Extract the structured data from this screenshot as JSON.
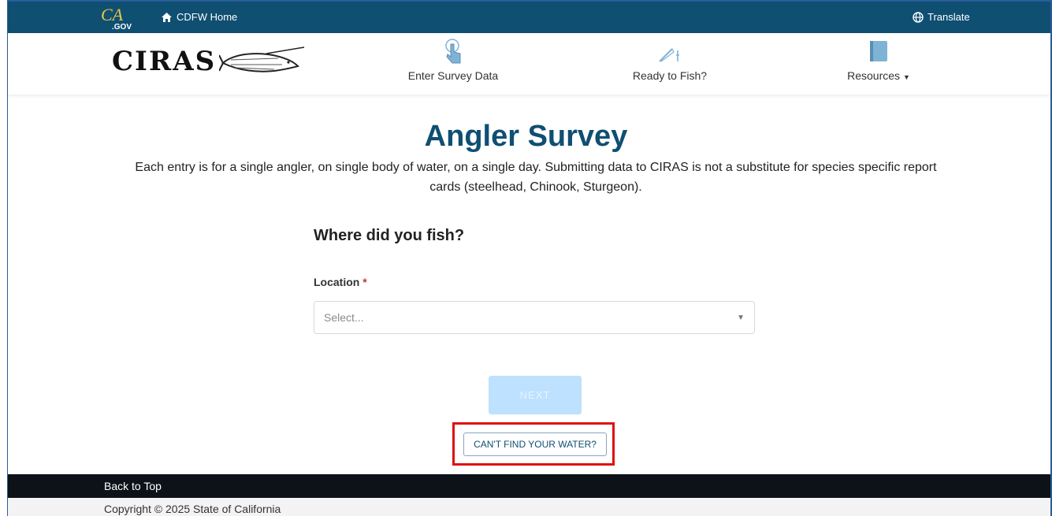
{
  "topbar": {
    "ca_logo_text": "CA",
    "ca_logo_gov": ".GOV",
    "home_label": "CDFW Home",
    "translate_label": "Translate"
  },
  "nav": {
    "brand": "CIRAS",
    "items": [
      {
        "label": "Enter Survey Data",
        "icon": "pointer-hand-icon"
      },
      {
        "label": "Ready to Fish?",
        "icon": "fishing-rod-icon"
      },
      {
        "label": "Resources",
        "icon": "book-icon"
      }
    ]
  },
  "main": {
    "title": "Angler Survey",
    "subtitle": "Each entry is for a single angler, on single body of water, on a single day. Submitting data to CIRAS is not a substitute for species specific report cards (steelhead, Chinook, Sturgeon).",
    "question": "Where did you fish?",
    "location_label": "Location",
    "required_mark": "*",
    "location_placeholder": "Select...",
    "next_label": "NEXT",
    "cant_find_label": "CAN'T FIND YOUR WATER?"
  },
  "footer": {
    "back_to_top": "Back to Top",
    "copyright": "Copyright © 2025 State of California"
  },
  "colors": {
    "topbar_bg": "#0f4f72",
    "title": "#0f4f72",
    "next_disabled": "#bee1ff",
    "highlight": "#e01010",
    "footer_bg": "#0d1218"
  }
}
